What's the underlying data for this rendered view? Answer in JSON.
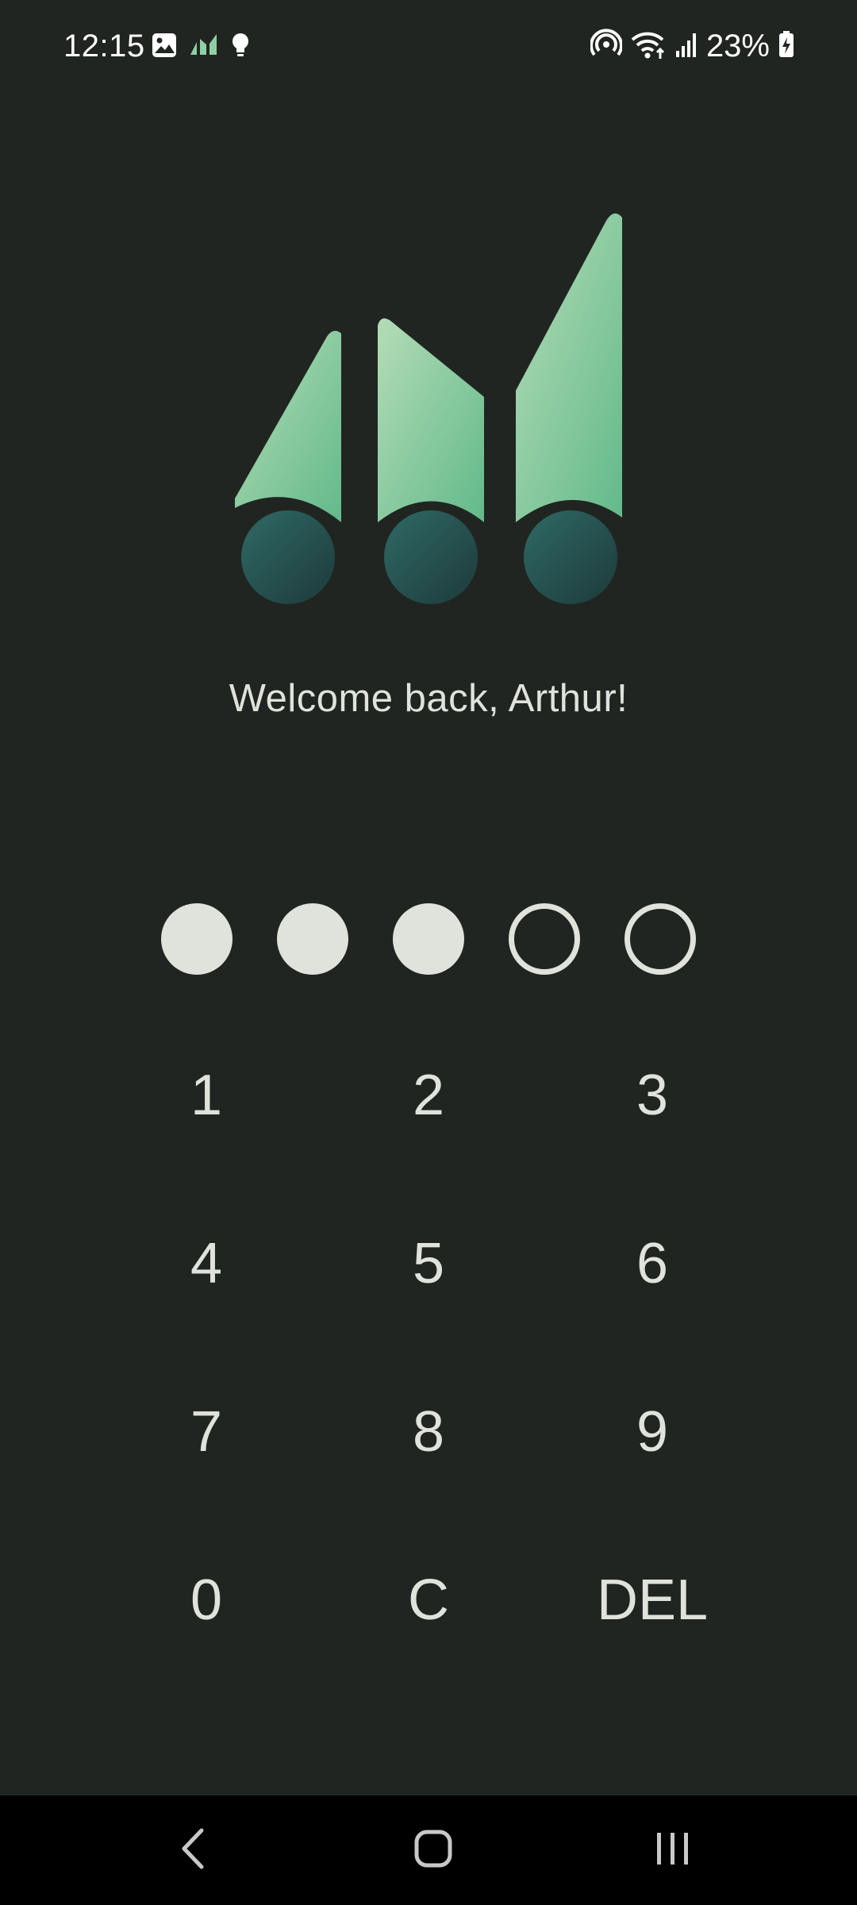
{
  "status_bar": {
    "time": "12:15",
    "battery_percent": "23%",
    "left_icons": [
      "gallery-icon",
      "app-logo-notification-icon",
      "lightbulb-icon"
    ],
    "right_icons": [
      "hotspot-icon",
      "wifi-icon",
      "signal-icon",
      "battery-charging-icon"
    ]
  },
  "welcome": {
    "message": "Welcome back, Arthur!"
  },
  "pin": {
    "length": 5,
    "entered": 3
  },
  "keypad": {
    "keys": [
      "1",
      "2",
      "3",
      "4",
      "5",
      "6",
      "7",
      "8",
      "9",
      "0",
      "C",
      "DEL"
    ]
  },
  "colors": {
    "background": "#212521",
    "text": "#dfe3dc",
    "logo_green_light": "#a7d3ab",
    "logo_green_dark": "#6bbf8c",
    "logo_circle_teal": "#2a5a58"
  },
  "nav_bar": {
    "buttons": [
      "back-icon",
      "home-icon",
      "recents-icon"
    ]
  }
}
